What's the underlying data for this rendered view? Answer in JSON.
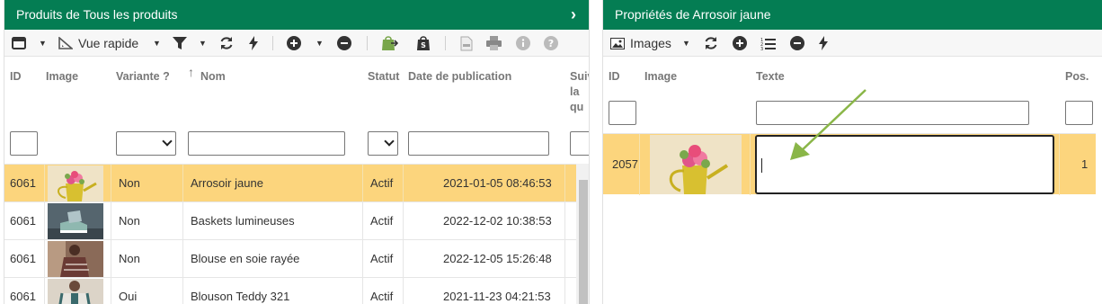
{
  "left_panel": {
    "title": "Produits de Tous les produits",
    "toolbar": {
      "view_label": "Vue rapide"
    },
    "columns": [
      "ID",
      "Image",
      "Variante ?",
      "Nom",
      "Statut",
      "Date de publication",
      "Suivi",
      "la",
      "qu"
    ],
    "rows": [
      {
        "id": "6061",
        "variant": "Non",
        "name": "Arrosoir jaune",
        "status": "Actif",
        "date": "2021-01-05 08:46:53",
        "selected": true
      },
      {
        "id": "6061",
        "variant": "Non",
        "name": "Baskets lumineuses",
        "status": "Actif",
        "date": "2022-12-02 10:38:53",
        "selected": false
      },
      {
        "id": "6061",
        "variant": "Non",
        "name": "Blouse en soie rayée",
        "status": "Actif",
        "date": "2022-12-05 15:26:48",
        "selected": false
      },
      {
        "id": "6061",
        "variant": "Oui",
        "name": "Blouson Teddy 321",
        "status": "Actif",
        "date": "2021-11-23 04:21:53",
        "selected": false
      }
    ]
  },
  "right_panel": {
    "title": "Propriétés de Arrosoir jaune",
    "toolbar": {
      "view_label": "Images"
    },
    "columns": [
      "ID",
      "Image",
      "Texte",
      "Pos."
    ],
    "row": {
      "id": "2057",
      "text": "",
      "pos": "1"
    }
  },
  "colors": {
    "header_green": "#047d53",
    "selection": "#fcd57d",
    "arrow": "#8ab648"
  }
}
